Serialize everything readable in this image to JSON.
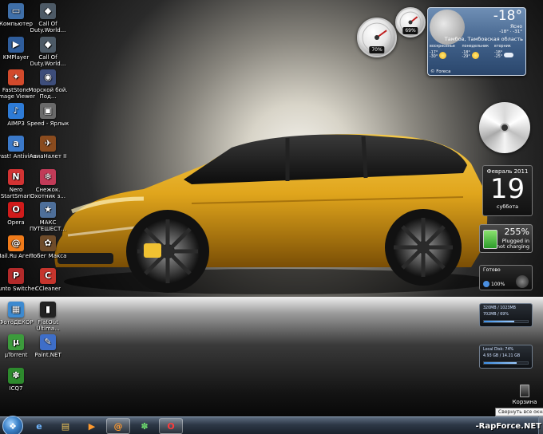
{
  "desktop": {
    "icons": [
      {
        "label": "Компьютер",
        "icon": "computer-icon",
        "color": "#3f6fa8",
        "glyph": "▭"
      },
      {
        "label": "Call Of Duty.World...",
        "icon": "game-icon",
        "color": "#4d5a66",
        "glyph": "◆"
      },
      {
        "label": "KMPlayer",
        "icon": "media-player-icon",
        "color": "#2f5d9b",
        "glyph": "▶"
      },
      {
        "label": "Call Of Duty.World...",
        "icon": "game-icon",
        "color": "#4d5a66",
        "glyph": "◆"
      },
      {
        "label": "FastStone Image Viewer",
        "icon": "image-viewer-icon",
        "color": "#d24a2c",
        "glyph": "✦"
      },
      {
        "label": "Морской бой. Под...",
        "icon": "game-icon",
        "color": "#3d4d7a",
        "glyph": "◉"
      },
      {
        "label": "AIMP3",
        "icon": "music-player-icon",
        "color": "#2e7bd6",
        "glyph": "♪"
      },
      {
        "label": "Speed - Ярлык",
        "icon": "shortcut-icon",
        "color": "#6a6a6a",
        "glyph": "▣"
      },
      {
        "label": "avast! Antivirus",
        "icon": "antivirus-icon",
        "color": "#3b79c9",
        "glyph": "a"
      },
      {
        "label": "АвиаНалет II",
        "icon": "game-icon",
        "color": "#8a4b1e",
        "glyph": "✈"
      },
      {
        "label": "Nero StartSmart",
        "icon": "burning-icon",
        "color": "#d23333",
        "glyph": "N"
      },
      {
        "label": "Снежок. Охотник з...",
        "icon": "game-icon",
        "color": "#c23b58",
        "glyph": "❄"
      },
      {
        "label": "Opera",
        "icon": "opera-browser-icon",
        "color": "#d01b1b",
        "glyph": "O"
      },
      {
        "label": "МАКС ПУТЕШЕСТ...",
        "icon": "game-icon",
        "color": "#4e6f9a",
        "glyph": "★"
      },
      {
        "label": "Mail.Ru Агент",
        "icon": "mail-agent-icon",
        "color": "#f07b1a",
        "glyph": "@"
      },
      {
        "label": "Побег Макса",
        "icon": "game-icon",
        "color": "#6f4c2a",
        "glyph": "✿"
      },
      {
        "label": "Punto Switcher",
        "icon": "keyboard-switcher-icon",
        "color": "#b22a2a",
        "glyph": "P"
      },
      {
        "label": "CCleaner",
        "icon": "cleaner-icon",
        "color": "#c5352d",
        "glyph": "C"
      },
      {
        "label": "ФотоДЕКОР",
        "icon": "photo-decor-icon",
        "color": "#3d8ad0",
        "glyph": "▦"
      },
      {
        "label": "FlatOut Ultima...",
        "icon": "game-icon",
        "color": "#222222",
        "glyph": "▮"
      },
      {
        "label": "µTorrent",
        "icon": "torrent-icon",
        "color": "#3c9b3c",
        "glyph": "µ"
      },
      {
        "label": "Paint.NET",
        "icon": "paint-icon",
        "color": "#3e6ec8",
        "glyph": "✎"
      },
      {
        "label": "ICQ7",
        "icon": "icq-icon",
        "color": "#2d8a2d",
        "glyph": "✽"
      }
    ],
    "recycle_bin": {
      "label": "Корзина"
    },
    "tooltip": "Свернуть все окна",
    "watermark": "-RapForce.NET"
  },
  "gadgets": {
    "cpu_meter": {
      "value": "70%",
      "level": 0.7
    },
    "ram_meter": {
      "value": "69%",
      "level": 0.69
    },
    "weather": {
      "temperature": "-18°",
      "condition": "Ясно",
      "hi_lo": "-18° · -31°",
      "city": "Тамбов, Тамбовская область",
      "provider": "© Foreca",
      "forecast": [
        {
          "day": "воскресенье",
          "high": "-17°",
          "low": "-30°",
          "icon": "sun-icon"
        },
        {
          "day": "понедельник",
          "high": "-18°",
          "low": "-29°",
          "icon": "sun-icon"
        },
        {
          "day": "вторник",
          "high": "-18°",
          "low": "-25°",
          "icon": "cloud-icon"
        }
      ]
    },
    "calendar": {
      "month_year": "Февраль 2011",
      "day": "19",
      "weekday": "суббота"
    },
    "battery": {
      "percent": "255%",
      "status_line1": "Plugged in",
      "status_line2": "not charging"
    },
    "download": {
      "title": "Готово",
      "percent": "100%"
    },
    "memory": {
      "line1": "320MB / 1023MB",
      "line2": "702MB / 69%",
      "level": 0.69
    },
    "disk": {
      "line1": "Local Disk: 74%",
      "line2": "4.93 GB / 14.21 GB",
      "level": 0.74
    }
  },
  "taskbar": {
    "buttons": [
      {
        "name": "taskbar-internet-explorer",
        "icon": "internet-explorer-icon",
        "glyph": "e",
        "color": "#6fb6ff",
        "active": false
      },
      {
        "name": "taskbar-explorer",
        "icon": "folder-icon",
        "glyph": "▤",
        "color": "#f2c75a",
        "active": false
      },
      {
        "name": "taskbar-media-player",
        "icon": "media-player-icon",
        "glyph": "▶",
        "color": "#ff9a2e",
        "active": false
      },
      {
        "name": "taskbar-mail-agent",
        "icon": "mail-agent-icon",
        "glyph": "@",
        "color": "#ff9a2e",
        "active": true
      },
      {
        "name": "taskbar-icq",
        "icon": "icq-icon",
        "glyph": "✽",
        "color": "#6fe06f",
        "active": false
      },
      {
        "name": "taskbar-opera",
        "icon": "opera-browser-icon",
        "glyph": "O",
        "color": "#ff3b3b",
        "active": true
      }
    ]
  },
  "colors": {
    "car_body": "#e0a51c",
    "car_shadow": "#8a5a06",
    "taskbar": "#2d3846"
  }
}
